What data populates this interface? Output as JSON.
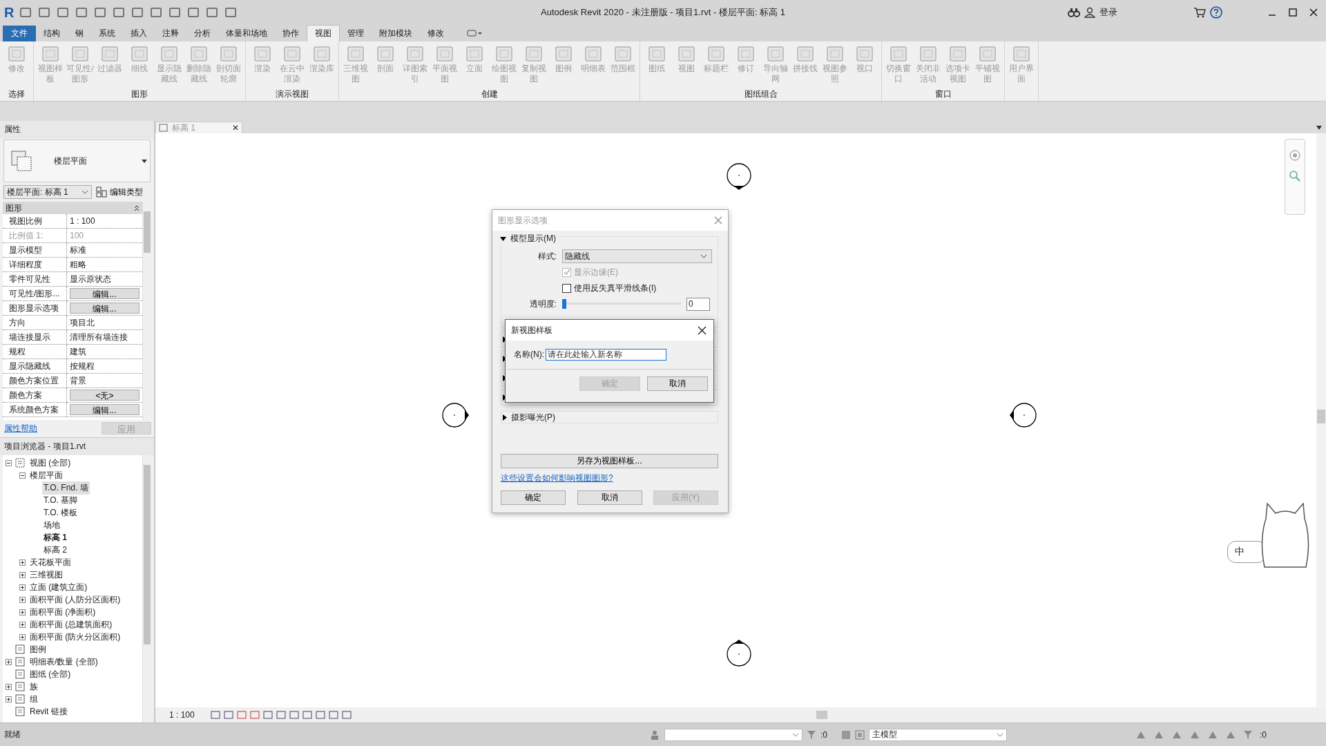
{
  "app": {
    "logo": "R",
    "title": "Autodesk Revit 2020 - 未注册版 - 项目1.rvt - 楼层平面: 标高 1",
    "sign_in": "登录"
  },
  "ribbon_tabs": [
    {
      "label": "文件",
      "kind": "file",
      "selected": false
    },
    {
      "label": "结构",
      "kind": "tab",
      "selected": false
    },
    {
      "label": "钢",
      "kind": "tab",
      "selected": false
    },
    {
      "label": "系统",
      "kind": "tab",
      "selected": false
    },
    {
      "label": "插入",
      "kind": "tab",
      "selected": false
    },
    {
      "label": "注释",
      "kind": "tab",
      "selected": false
    },
    {
      "label": "分析",
      "kind": "tab",
      "selected": false
    },
    {
      "label": "体量和场地",
      "kind": "tab",
      "selected": false
    },
    {
      "label": "协作",
      "kind": "tab",
      "selected": false
    },
    {
      "label": "视图",
      "kind": "tab",
      "selected": true
    },
    {
      "label": "管理",
      "kind": "tab",
      "selected": false
    },
    {
      "label": "附加模块",
      "kind": "tab",
      "selected": false
    },
    {
      "label": "修改",
      "kind": "tab",
      "selected": false
    }
  ],
  "ribbon_panels": [
    {
      "label": "选择",
      "buttons": [
        "修改"
      ]
    },
    {
      "label": "图形",
      "buttons": [
        "视图样板",
        "可见性/图形",
        "过滤器",
        "细线",
        "显示隐藏线",
        "删除隐藏线",
        "剖切面轮廓"
      ]
    },
    {
      "label": "演示视图",
      "buttons": [
        "渲染",
        "在云中渲染",
        "渲染库"
      ]
    },
    {
      "label": "创建",
      "buttons": [
        "三维视图",
        "剖面",
        "详图索引",
        "平面视图",
        "立面",
        "绘图视图",
        "复制视图",
        "图例",
        "明细表",
        "范围框"
      ]
    },
    {
      "label": "图纸组合",
      "buttons": [
        "图纸",
        "视图",
        "标题栏",
        "修订",
        "导向轴网",
        "拼接线",
        "视图参照",
        "视口"
      ]
    },
    {
      "label": "窗口",
      "buttons": [
        "切换窗口",
        "关闭非活动",
        "选项卡视图",
        "平铺视图"
      ]
    },
    {
      "buttons": [
        "用户界面"
      ]
    }
  ],
  "properties": {
    "title": "属性",
    "type_name": "楼层平面",
    "instance": "楼层平面: 标高 1",
    "edit_type": "编辑类型",
    "group": "图形",
    "rows": [
      {
        "name": "视图比例",
        "value": "1 : 100",
        "kind": "text",
        "disabled": false
      },
      {
        "name": "比例值 1:",
        "value": "100",
        "kind": "text",
        "disabled": true
      },
      {
        "name": "显示模型",
        "value": "标准",
        "kind": "text",
        "disabled": false
      },
      {
        "name": "详细程度",
        "value": "粗略",
        "kind": "text",
        "disabled": false
      },
      {
        "name": "零件可见性",
        "value": "显示原状态",
        "kind": "text",
        "disabled": false
      },
      {
        "name": "可见性/图形...",
        "value": "编辑...",
        "kind": "button",
        "disabled": false
      },
      {
        "name": "图形显示选项",
        "value": "编辑...",
        "kind": "button",
        "disabled": false
      },
      {
        "name": "方向",
        "value": "项目北",
        "kind": "text",
        "disabled": false
      },
      {
        "name": "墙连接显示",
        "value": "清理所有墙连接",
        "kind": "text",
        "disabled": false
      },
      {
        "name": "规程",
        "value": "建筑",
        "kind": "text",
        "disabled": false
      },
      {
        "name": "显示隐藏线",
        "value": "按规程",
        "kind": "text",
        "disabled": false
      },
      {
        "name": "颜色方案位置",
        "value": "背景",
        "kind": "text",
        "disabled": false
      },
      {
        "name": "颜色方案",
        "value": "<无>",
        "kind": "button",
        "disabled": false
      },
      {
        "name": "系统颜色方案",
        "value": "编辑...",
        "kind": "button",
        "disabled": false
      }
    ],
    "help_link": "属性帮助",
    "apply": "应用"
  },
  "project_browser": {
    "title": "项目浏览器 - 项目1.rvt",
    "items": [
      {
        "label": "视图 (全部)",
        "expanded": true,
        "children": [
          {
            "label": "楼层平面",
            "expanded": true,
            "children": [
              {
                "label": "T.O. Fnd. 墙",
                "selected": true,
                "current": false
              },
              {
                "label": "T.O. 基脚",
                "selected": false,
                "current": false
              },
              {
                "label": "T.O. 楼板",
                "selected": false,
                "current": false
              },
              {
                "label": "场地",
                "selected": false,
                "current": false
              },
              {
                "label": "标高 1",
                "selected": false,
                "current": true
              },
              {
                "label": "标高 2",
                "selected": false,
                "current": false
              }
            ]
          },
          {
            "label": "天花板平面",
            "expanded": false
          },
          {
            "label": "三维视图",
            "expanded": false
          },
          {
            "label": "立面 (建筑立面)",
            "expanded": false
          },
          {
            "label": "面积平面 (人防分区面积)",
            "expanded": false
          },
          {
            "label": "面积平面 (净面积)",
            "expanded": false
          },
          {
            "label": "面积平面 (总建筑面积)",
            "expanded": false
          },
          {
            "label": "面积平面 (防火分区面积)",
            "expanded": false
          }
        ]
      },
      {
        "label": "图例"
      },
      {
        "label": "明细表/数量 (全部)",
        "expanded": false
      },
      {
        "label": "图纸 (全部)"
      },
      {
        "label": "族",
        "expanded": false
      },
      {
        "label": "组",
        "expanded": false
      },
      {
        "label": "Revit 链接"
      }
    ]
  },
  "view_tab": {
    "label": "标高 1",
    "close": "✕"
  },
  "view_control": {
    "scale": "1 : 100"
  },
  "graphics_dialog": {
    "title": "图形显示选项",
    "section": "模型显示(M)",
    "style_label": "样式:",
    "style_value": "隐藏线",
    "checks": [
      {
        "label": "显示边缘(E)",
        "checked": true,
        "disabled": true
      },
      {
        "label": "使用反失真平滑线条(I)",
        "checked": false,
        "disabled": false
      }
    ],
    "transparency_label": "透明度:",
    "transparency": {
      "level": 0
    },
    "transparency_value": "0",
    "exposure": "摄影曝光(P)",
    "save_template": "另存为视图样板...",
    "help_link": "这些设置会如何影响视图图形?",
    "ok": "确定",
    "cancel": "取消",
    "apply": "应用(Y)"
  },
  "new_template_dialog": {
    "title": "新视图样板",
    "name_label": "名称(N):",
    "name_value": "请在此处输入新名称",
    "ok": "确定",
    "ok_disabled": true,
    "cancel": "取消"
  },
  "ime": {
    "label": "中"
  },
  "status_bar": {
    "text": "就绪",
    "count_1": ":0",
    "model": "主模型",
    "count_2": ":0"
  }
}
